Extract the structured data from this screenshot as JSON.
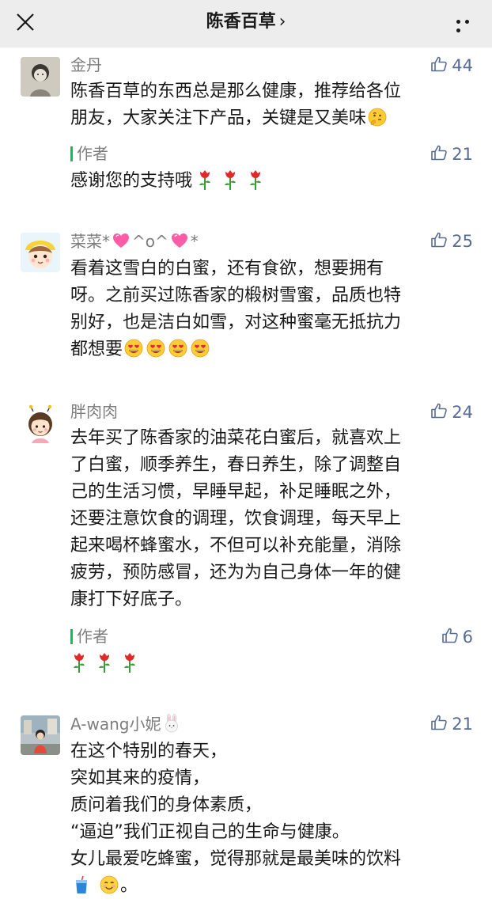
{
  "nav": {
    "title": "陈香百草",
    "chevron": "›",
    "close_icon": "close-icon",
    "more_icon": "more-icon"
  },
  "colors": {
    "nav_bg": "#ededed",
    "link_blue": "#576b95",
    "author_green": "#07c160",
    "nickname_gray": "#7d7d7d",
    "text": "#191919"
  },
  "comments": [
    {
      "nickname": "金丹",
      "likes": "44",
      "lines": [
        "陈香百草的东西总是那么健康，推荐给各位",
        "朋友，大家关注下产品，关键是又美味"
      ],
      "reply": {
        "author_label": "作者",
        "likes": "21",
        "text": "感谢您的支持哦"
      }
    },
    {
      "nickname": "菜菜*",
      "nickname_mid": "^o^",
      "nickname_end": "*",
      "likes": "25",
      "lines": [
        "看着这雪白的白蜜，还有食欲，想要拥有",
        "呀。之前买过陈香家的椴树雪蜜，品质也特",
        "别好，也是洁白如雪，对这种蜜毫无抵抗力",
        "都想要"
      ]
    },
    {
      "nickname": "胖肉肉",
      "likes": "24",
      "lines": [
        "去年买了陈香家的油菜花白蜜后，就喜欢上",
        "了白蜜，顺季养生，春日养生，除了调整自",
        "己的生活习惯，早睡早起，补足睡眠之外，",
        "还要注意饮食的调理，饮食调理，每天早上",
        "起来喝杯蜂蜜水，不但可以补充能量，消除",
        "疲劳，预防感冒，还为为自己身体一年的健",
        "康打下好底子。"
      ],
      "reply": {
        "author_label": "作者",
        "likes": "6",
        "text": ""
      }
    },
    {
      "nickname": "A-wang小妮",
      "likes": "21",
      "lines": [
        "在这个特别的春天，",
        "突如其来的疫情，",
        "质问着我们的身体素质，",
        "“逼迫”我们正视自己的生命与健康。",
        "女儿最爱吃蜂蜜，觉得那就是最美味的饮料"
      ],
      "last_line_end": "。"
    }
  ]
}
